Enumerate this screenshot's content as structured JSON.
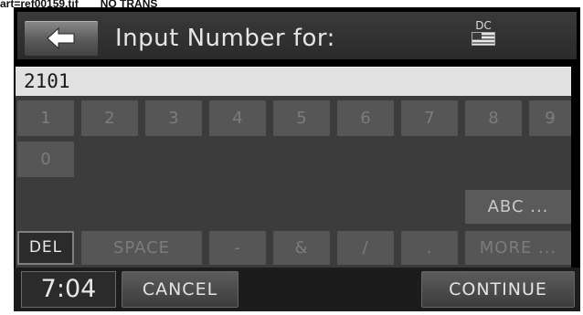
{
  "caption": {
    "filename": "art=ref00159.tif",
    "note": "NO TRANS"
  },
  "header": {
    "title": "Input Number for:",
    "region_label": "DC",
    "region_flag_icon": "us-flag-icon"
  },
  "entry": {
    "value": "2101"
  },
  "keypad": {
    "digits": [
      "1",
      "2",
      "3",
      "4",
      "5",
      "6",
      "7",
      "8",
      "9",
      "0"
    ],
    "abc_label": "ABC ...",
    "del_label": "DEL",
    "space_label": "SPACE",
    "symbols": [
      "-",
      "&",
      "/",
      "."
    ],
    "more_label": "MORE ..."
  },
  "footer": {
    "clock": "7:04",
    "cancel_label": "CANCEL",
    "continue_label": "CONTINUE"
  }
}
